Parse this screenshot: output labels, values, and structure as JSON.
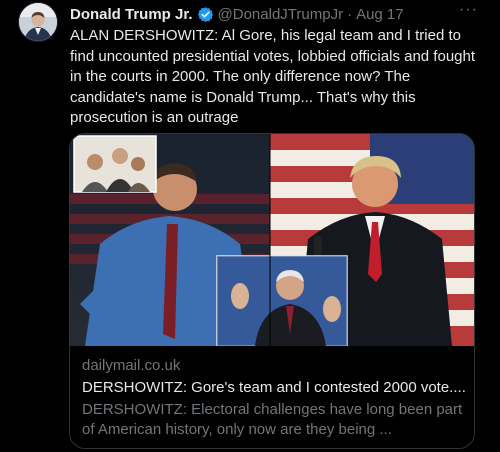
{
  "tweet": {
    "author_name": "Donald Trump Jr.",
    "handle": "@DonaldJTrumpJr",
    "separator": "·",
    "date": "Aug 17",
    "more_label": "···",
    "text": "ALAN DERSHOWITZ: Al Gore, his legal team and I tried to find uncounted presidential votes, lobbied officials and fought in the courts in 2000. The only difference now? The candidate's name is Donald Trump... That's why this prosecution is an outrage"
  },
  "card": {
    "domain": "dailymail.co.uk",
    "title": "DERSHOWITZ: Gore's team and I contested 2000 vote....",
    "description": "DERSHOWITZ: Electoral challenges have long been part of American history, only now are they being ..."
  },
  "colors": {
    "background": "#000000",
    "primary_text": "#e7e9ea",
    "secondary_text": "#71767b",
    "verified_blue": "#1d9bf0",
    "border": "#2f3336"
  }
}
